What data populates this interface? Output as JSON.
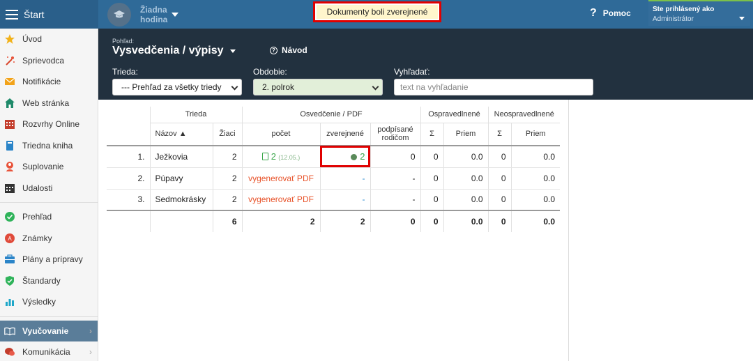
{
  "topbar": {
    "start_label": "Štart",
    "school_name_line1": "Žiadna",
    "school_name_line2": "hodina",
    "toast": "Dokumenty boli zverejnené",
    "help_label": "Pomoc",
    "user_line1": "Ste prihlásený ako",
    "user_line2": "Administrátor"
  },
  "sidebar": {
    "items": [
      {
        "label": "Úvod",
        "icon": "star-icon"
      },
      {
        "label": "Sprievodca",
        "icon": "magic-wand-icon"
      },
      {
        "label": "Notifikácie",
        "icon": "envelope-icon"
      },
      {
        "label": "Web stránka",
        "icon": "home-icon"
      },
      {
        "label": "Rozvrhy Online",
        "icon": "calendar-grid-icon"
      },
      {
        "label": "Triedna kniha",
        "icon": "book-icon"
      },
      {
        "label": "Suplovanie",
        "icon": "person-icon"
      },
      {
        "label": "Udalosti",
        "icon": "calendar-icon"
      },
      {
        "label": "Prehľad",
        "icon": "check-circle-icon"
      },
      {
        "label": "Známky",
        "icon": "grade-icon"
      },
      {
        "label": "Plány a prípravy",
        "icon": "briefcase-icon"
      },
      {
        "label": "Štandardy",
        "icon": "shield-check-icon"
      },
      {
        "label": "Výsledky",
        "icon": "bar-chart-icon"
      },
      {
        "label": "Vyučovanie",
        "icon": "open-book-icon"
      },
      {
        "label": "Komunikácia",
        "icon": "chat-icon"
      }
    ],
    "colors": {
      "accent": "#5a7d99"
    }
  },
  "panel": {
    "crumb": "Pohľad:",
    "title": "Vysvedčenia / výpisy",
    "guide_label": "Návod",
    "class_label": "Trieda:",
    "class_value": "--- Prehľad za všetky triedy",
    "period_label": "Obdobie:",
    "period_value": "2. polrok",
    "search_label": "Vyhľadať:",
    "search_placeholder": "text na vyhľadanie"
  },
  "table": {
    "group_headers": {
      "class": "Trieda",
      "certificate": "Osvedčenie / PDF",
      "excused": "Ospravedlnené",
      "unexcused": "Neospravedlnené"
    },
    "headers": {
      "name": "Názov ▲",
      "students": "Žiaci",
      "count": "počet",
      "published": "zverejnené",
      "signed_line1": "podpísané",
      "signed_line2": "rodičom",
      "sum1": "Σ",
      "avg1": "Priem",
      "sum2": "Σ",
      "avg2": "Priem"
    },
    "rows": [
      {
        "num": "1.",
        "name": "Ježkovia",
        "students": "2",
        "count": "2",
        "count_date": "(12.05.)",
        "published": "2",
        "signed": "0",
        "ex_sum": "0",
        "ex_avg": "0.0",
        "un_sum": "0",
        "un_avg": "0.0"
      },
      {
        "num": "2.",
        "name": "Púpavy",
        "students": "2",
        "count": "vygenerovať PDF",
        "published": "-",
        "signed": "-",
        "ex_sum": "0",
        "ex_avg": "0.0",
        "un_sum": "0",
        "un_avg": "0.0"
      },
      {
        "num": "3.",
        "name": "Sedmokrásky",
        "students": "2",
        "count": "vygenerovať PDF",
        "published": "-",
        "signed": "-",
        "ex_sum": "0",
        "ex_avg": "0.0",
        "un_sum": "0",
        "un_avg": "0.0"
      }
    ],
    "totals": {
      "students": "6",
      "count": "2",
      "published": "2",
      "signed": "0",
      "ex_sum": "0",
      "ex_avg": "0.0",
      "un_sum": "0",
      "un_avg": "0.0"
    }
  }
}
